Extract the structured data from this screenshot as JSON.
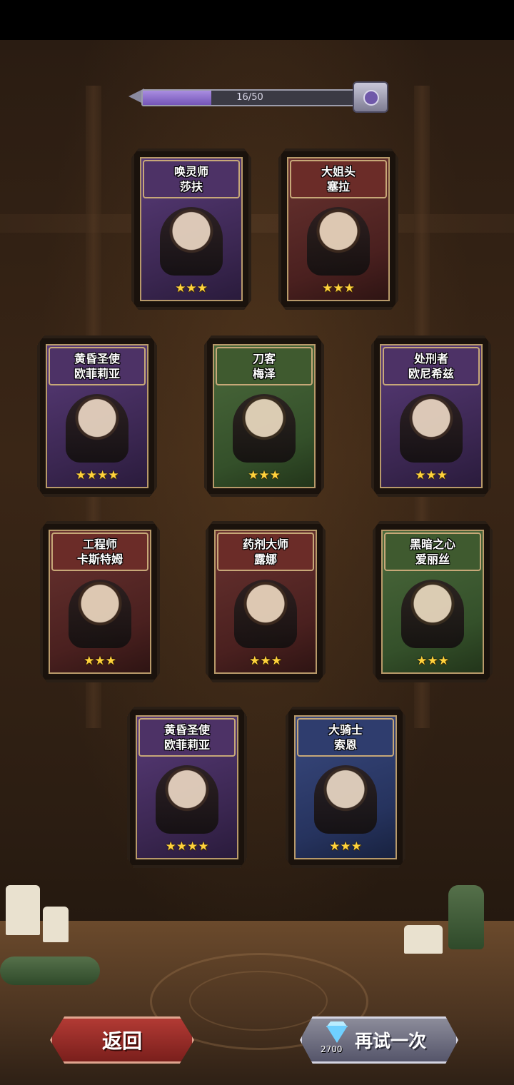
{
  "progress": {
    "current": 16,
    "max": 50,
    "text": "16/50"
  },
  "cards": [
    {
      "title": "唤灵师",
      "name": "莎扶",
      "stars": "★★★",
      "star_count": 3,
      "theme": "purple",
      "glow": false
    },
    {
      "title": "大姐头",
      "name": "塞拉",
      "stars": "★★★",
      "star_count": 3,
      "theme": "red",
      "glow": false
    },
    {
      "title": "黄昏圣使",
      "name": "欧菲莉亚",
      "stars": "★★★★",
      "star_count": 4,
      "theme": "purple",
      "glow": true
    },
    {
      "title": "刀客",
      "name": "梅泽",
      "stars": "★★★",
      "star_count": 3,
      "theme": "green",
      "glow": false
    },
    {
      "title": "处刑者",
      "name": "欧尼希兹",
      "stars": "★★★",
      "star_count": 3,
      "theme": "purple",
      "glow": false
    },
    {
      "title": "工程师",
      "name": "卡斯特姆",
      "stars": "★★★",
      "star_count": 3,
      "theme": "red",
      "glow": false
    },
    {
      "title": "药剂大师",
      "name": "露娜",
      "stars": "★★★",
      "star_count": 3,
      "theme": "red",
      "glow": false
    },
    {
      "title": "黑暗之心",
      "name": "爱丽丝",
      "stars": "★★★",
      "star_count": 3,
      "theme": "green",
      "glow": false
    },
    {
      "title": "黄昏圣使",
      "name": "欧菲莉亚",
      "stars": "★★★★",
      "star_count": 4,
      "theme": "purple",
      "glow": true
    },
    {
      "title": "大骑士",
      "name": "索恩",
      "stars": "★★★",
      "star_count": 3,
      "theme": "blue",
      "glow": false
    }
  ],
  "buttons": {
    "back_label": "返回",
    "retry_label": "再试一次",
    "retry_cost": "2700",
    "retry_cost_icon": "diamond-icon"
  }
}
